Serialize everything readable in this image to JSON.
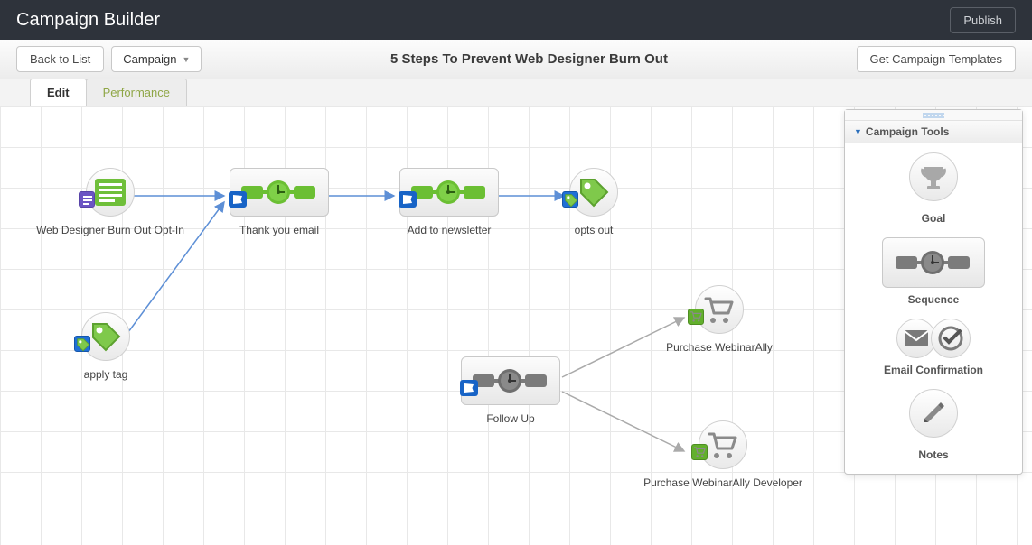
{
  "header": {
    "title": "Campaign Builder",
    "publish_label": "Publish"
  },
  "toolbar": {
    "back_label": "Back to List",
    "selector_label": "Campaign",
    "campaign_title": "5 Steps To Prevent Web Designer Burn Out",
    "get_templates_label": "Get Campaign Templates"
  },
  "tabs": {
    "edit": "Edit",
    "performance": "Performance"
  },
  "nodes": {
    "optin": {
      "label": "Web Designer Burn Out Opt-In",
      "type": "form-goal"
    },
    "thankyou": {
      "label": "Thank you email",
      "type": "sequence"
    },
    "newsletter": {
      "label": "Add to newsletter",
      "type": "sequence"
    },
    "optsout": {
      "label": "opts out",
      "type": "tag-goal"
    },
    "applytag": {
      "label": "apply tag",
      "type": "tag-goal"
    },
    "followup": {
      "label": "Follow Up",
      "type": "sequence"
    },
    "purchase1": {
      "label": "Purchase WebinarAlly",
      "type": "purchase-goal"
    },
    "purchase2": {
      "label": "Purchase WebinarAlly Developer",
      "type": "purchase-goal"
    }
  },
  "tools": {
    "panel_title": "Campaign Tools",
    "goal": "Goal",
    "sequence": "Sequence",
    "email_confirmation": "Email Confirmation",
    "notes": "Notes"
  }
}
